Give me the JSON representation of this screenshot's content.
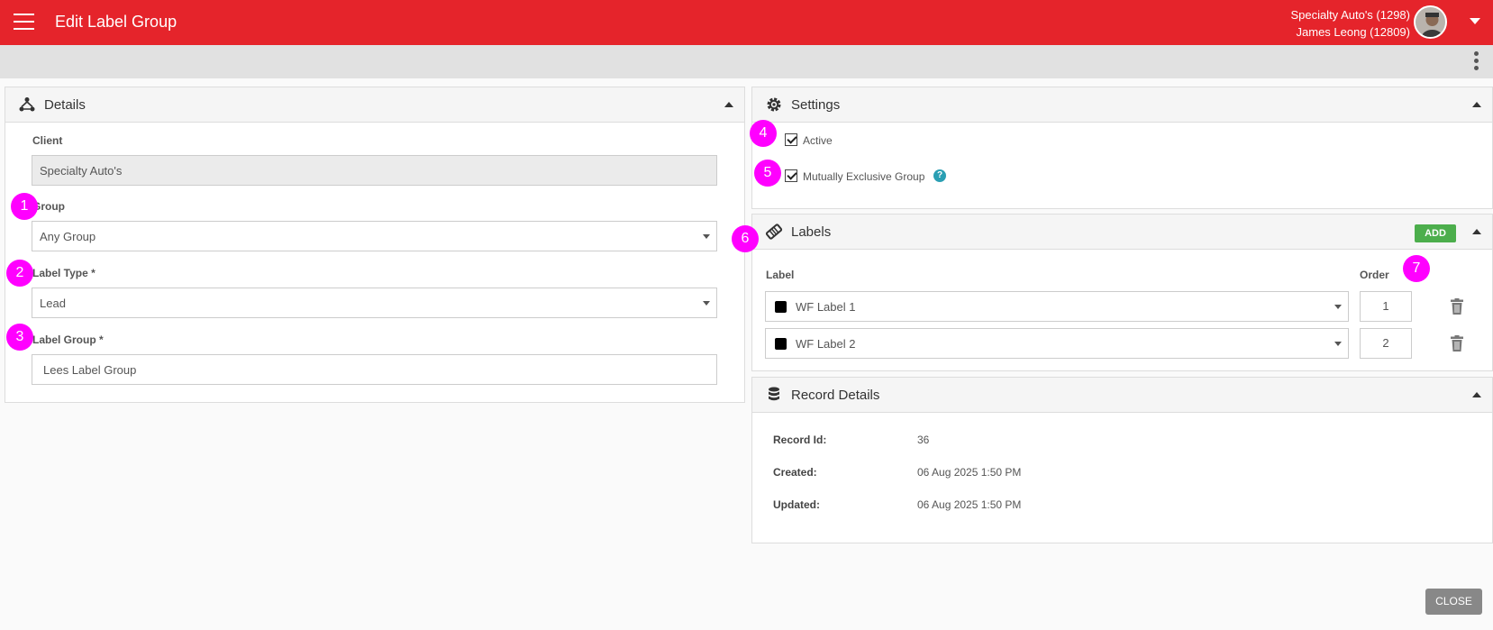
{
  "header": {
    "title": "Edit Label Group",
    "account_line1": "Specialty Auto's (1298)",
    "account_line2": "James Leong (12809)"
  },
  "details": {
    "title": "Details",
    "client_label": "Client",
    "client_value": "Specialty Auto's",
    "group_label": "Group",
    "group_value": "Any Group",
    "label_type_label": "Label Type *",
    "label_type_value": "Lead",
    "label_group_label": "Label Group *",
    "label_group_value": "Lees Label Group"
  },
  "settings": {
    "title": "Settings",
    "active_label": "Active",
    "active_checked": true,
    "mutually_exclusive_label": "Mutually Exclusive Group",
    "mutually_exclusive_checked": true,
    "help_glyph": "?"
  },
  "labels": {
    "title": "Labels",
    "add_label": "ADD",
    "col_label": "Label",
    "col_order": "Order",
    "rows": [
      {
        "label": "WF Label 1",
        "order": "1",
        "color": "#000000"
      },
      {
        "label": "WF Label 2",
        "order": "2",
        "color": "#000000"
      }
    ]
  },
  "record_details": {
    "title": "Record Details",
    "record_id_label": "Record Id:",
    "record_id_value": "36",
    "created_label": "Created:",
    "created_value": "06 Aug 2025 1:50 PM",
    "updated_label": "Updated:",
    "updated_value": "06 Aug 2025 1:50 PM"
  },
  "annotations": [
    "1",
    "2",
    "3",
    "4",
    "5",
    "6",
    "7"
  ],
  "footer": {
    "close_label": "CLOSE"
  },
  "colors": {
    "brand": "#e5242b",
    "badge": "#ff00ff",
    "add": "#4cae4c",
    "help": "#2a9fb3"
  }
}
